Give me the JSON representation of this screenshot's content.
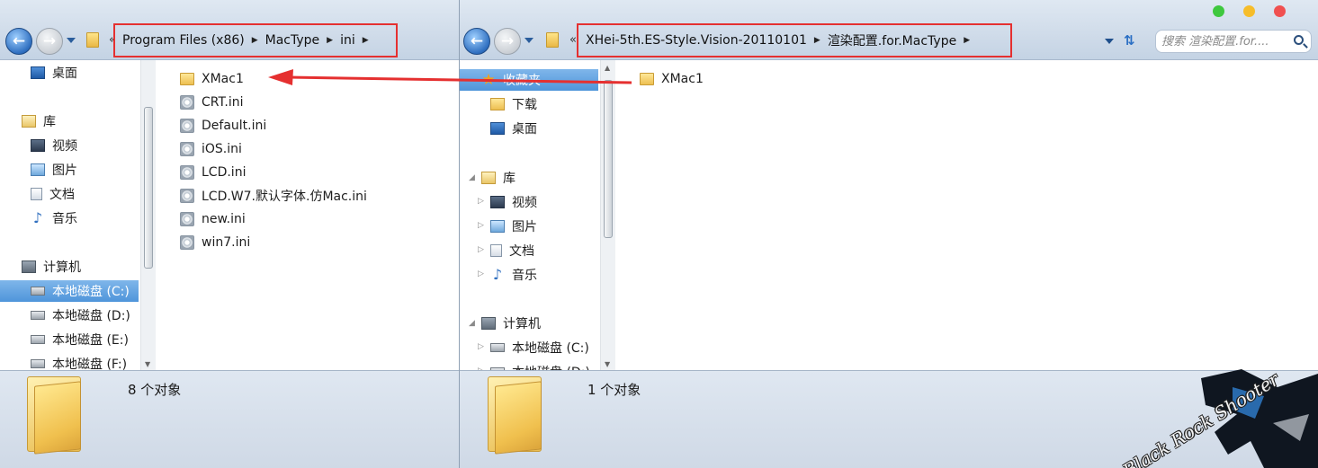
{
  "left_window": {
    "breadcrumb": [
      "Program Files (x86)",
      "MacType",
      "ini"
    ],
    "nav_items": [
      {
        "label": "桌面",
        "icon": "desktop-icon"
      },
      {
        "label": "库",
        "icon": "library-icon"
      },
      {
        "label": "视频",
        "icon": "video-icon"
      },
      {
        "label": "图片",
        "icon": "pictures-icon"
      },
      {
        "label": "文档",
        "icon": "documents-icon"
      },
      {
        "label": "音乐",
        "icon": "music-icon"
      },
      {
        "label": "计算机",
        "icon": "computer-icon"
      },
      {
        "label": "本地磁盘 (C:)",
        "icon": "drive-icon",
        "selected": true
      },
      {
        "label": "本地磁盘 (D:)",
        "icon": "drive-icon"
      },
      {
        "label": "本地磁盘 (E:)",
        "icon": "drive-icon"
      },
      {
        "label": "本地磁盘 (F:)",
        "icon": "drive-icon"
      }
    ],
    "files": [
      {
        "name": "XMac1",
        "type": "folder"
      },
      {
        "name": "CRT.ini",
        "type": "ini"
      },
      {
        "name": "Default.ini",
        "type": "ini"
      },
      {
        "name": "iOS.ini",
        "type": "ini"
      },
      {
        "name": "LCD.ini",
        "type": "ini"
      },
      {
        "name": "LCD.W7.默认字体.仿Mac.ini",
        "type": "ini"
      },
      {
        "name": "new.ini",
        "type": "ini"
      },
      {
        "name": "win7.ini",
        "type": "ini"
      }
    ],
    "status": "8 个对象"
  },
  "right_window": {
    "breadcrumb": [
      "XHei-5th.ES-Style.Vision-20110101",
      "渲染配置.for.MacType"
    ],
    "search_placeholder": "搜索 渲染配置.for....",
    "nav_items": [
      {
        "label": "收藏夹",
        "icon": "star-icon",
        "selected": true
      },
      {
        "label": "下载",
        "icon": "downloads-icon"
      },
      {
        "label": "桌面",
        "icon": "desktop-icon"
      },
      {
        "label": "库",
        "icon": "library-icon"
      },
      {
        "label": "视频",
        "icon": "video-icon"
      },
      {
        "label": "图片",
        "icon": "pictures-icon"
      },
      {
        "label": "文档",
        "icon": "documents-icon"
      },
      {
        "label": "音乐",
        "icon": "music-icon"
      },
      {
        "label": "计算机",
        "icon": "computer-icon"
      },
      {
        "label": "本地磁盘 (C:)",
        "icon": "drive-icon"
      },
      {
        "label": "本地磁盘 (D:)",
        "icon": "drive-icon"
      }
    ],
    "files": [
      {
        "name": "XMac1",
        "type": "folder"
      }
    ],
    "status": "1 个对象"
  },
  "colors": {
    "annotation_red": "#e53030",
    "selection_blue": "#5b9ee0",
    "window_green": "#3ec83e",
    "window_yellow": "#f6bd2a",
    "window_red": "#f05050"
  },
  "watermark": "Black Rock Shooter"
}
